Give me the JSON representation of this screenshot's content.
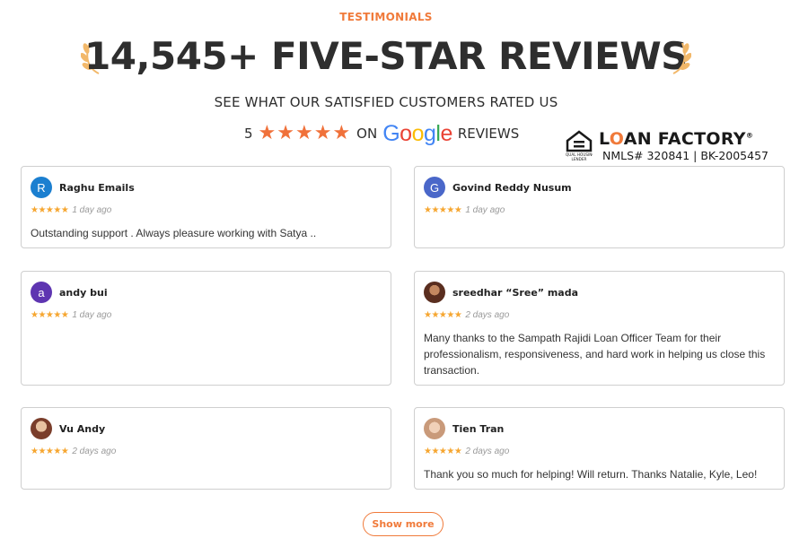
{
  "section": {
    "eyebrow": "TESTIMONIALS",
    "headline": "14,545+ FIVE-STAR REVIEWS",
    "subhead": "SEE WHAT OUR SATISFIED CUSTOMERS RATED US"
  },
  "rating": {
    "score": "5",
    "stars": "★★★★★",
    "on_text": "ON",
    "google": [
      "G",
      "o",
      "o",
      "g",
      "l",
      "e"
    ],
    "reviews_text": "REVIEWS"
  },
  "lender": {
    "icon": "equal-housing-lender-icon",
    "eho_caption": "EQUAL HOUSING LENDER",
    "name_prefix": "L",
    "name_o": "O",
    "name_suffix": "AN FACTORY",
    "trademark": "®",
    "nmls": "NMLS# 320841 | BK-2005457"
  },
  "reviews": [
    {
      "initial": "R",
      "avatar_color": "#1b7fd0",
      "name": "Raghu Emails",
      "stars": "★★★★★",
      "date": "1 day ago",
      "text": "Outstanding support . Always pleasure working with Satya .."
    },
    {
      "initial": "G",
      "avatar_color": "#4a67c9",
      "name": "Govind Reddy Nusum",
      "stars": "★★★★★",
      "date": "1 day ago",
      "text": ""
    },
    {
      "initial": "a",
      "avatar_color": "#5e35b1",
      "name": "andy bui",
      "stars": "★★★★★",
      "date": "1 day ago",
      "text": ""
    },
    {
      "initial": "",
      "avatar_color": "",
      "name": "sreedhar “Sree” mada",
      "stars": "★★★★★",
      "date": "2 days ago",
      "text": "Many thanks to the Sampath Rajidi Loan Officer Team for their professionalism, responsiveness, and hard work in helping us close this transaction."
    },
    {
      "initial": "",
      "avatar_color": "",
      "name": "Vu Andy",
      "stars": "★★★★★",
      "date": "2 days ago",
      "text": ""
    },
    {
      "initial": "",
      "avatar_color": "",
      "name": "Tien Tran",
      "stars": "★★★★★",
      "date": "2 days ago",
      "text": "Thank you so much for helping! Will return. Thanks Natalie, Kyle, Leo!"
    }
  ],
  "actions": {
    "show_more": "Show more"
  },
  "colors": {
    "accent": "#f07a3a",
    "review_star": "#f6a630",
    "headline": "#2e2e2e"
  }
}
